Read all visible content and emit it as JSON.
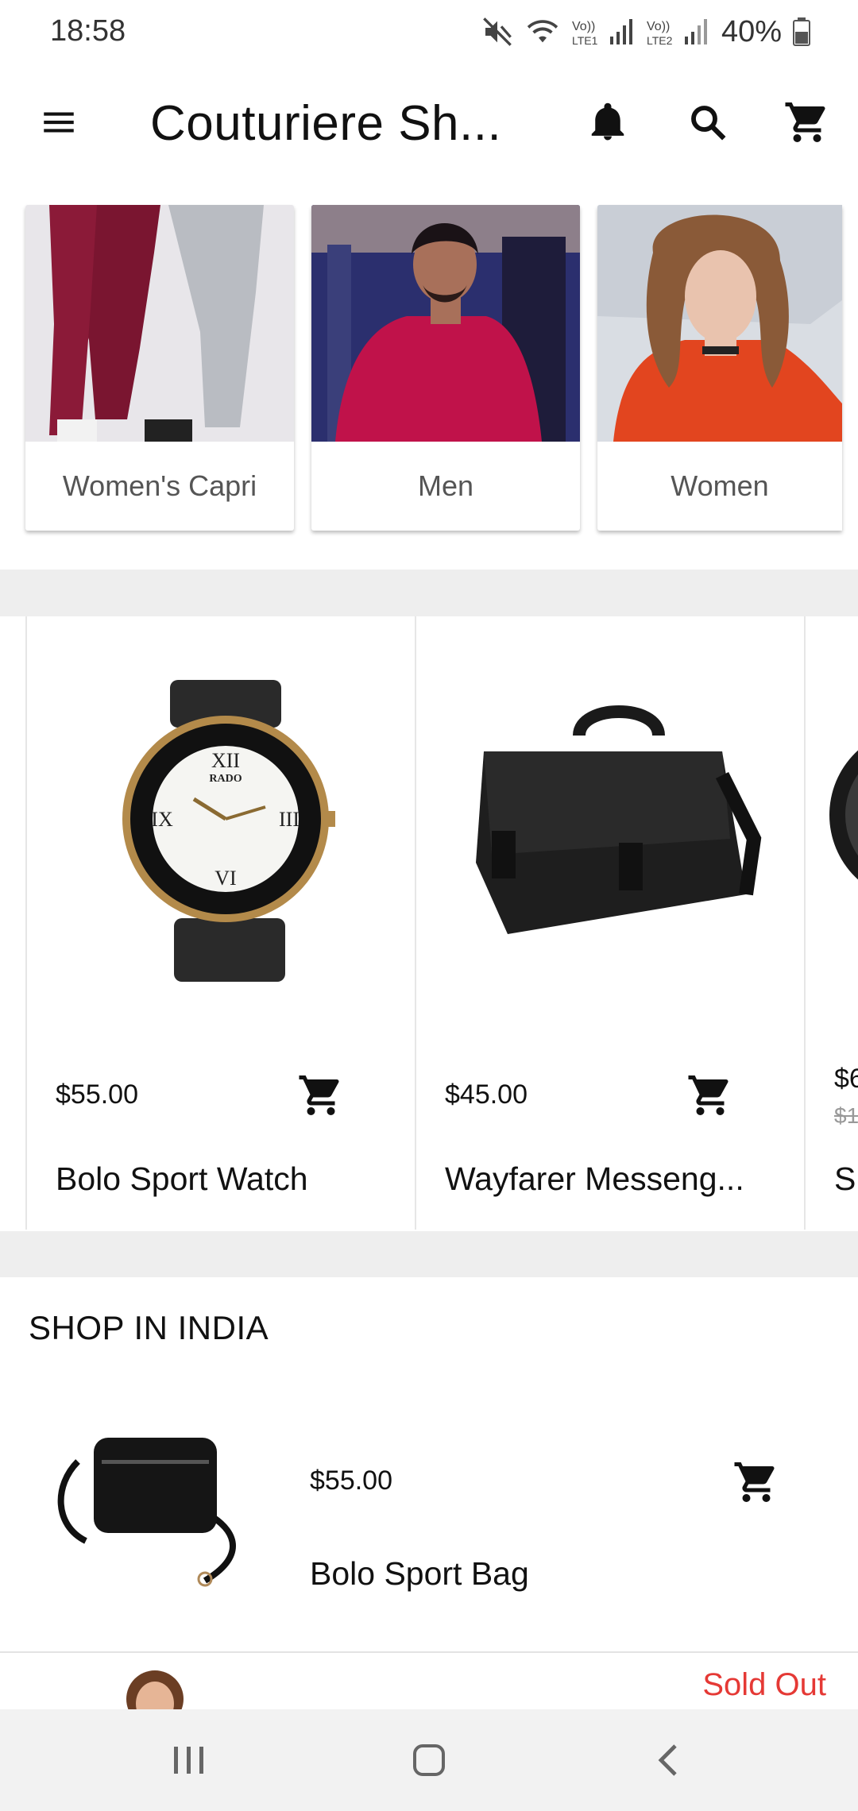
{
  "status_bar": {
    "time": "18:58",
    "battery": "40%",
    "icons": [
      "mute-icon",
      "wifi-icon",
      "lte1-signal-icon",
      "lte2-signal-icon",
      "battery-icon"
    ]
  },
  "app_bar": {
    "title": "Couturiere Sh...",
    "icons": [
      "menu-icon",
      "bell-icon",
      "search-icon",
      "cart-icon"
    ]
  },
  "categories": [
    {
      "label": "Women's Capri"
    },
    {
      "label": "Men"
    },
    {
      "label": "Women"
    }
  ],
  "products": [
    {
      "price": "$55.00",
      "name": "Bolo Sport Watch"
    },
    {
      "price": "$45.00",
      "name": "Wayfarer Messeng..."
    },
    {
      "price": "$6",
      "old_price": "$1",
      "name": "S"
    }
  ],
  "section": {
    "title": "SHOP IN INDIA",
    "items": [
      {
        "price": "$55.00",
        "name": "Bolo Sport Bag"
      },
      {
        "badge": "Sold Out"
      }
    ]
  },
  "colors": {
    "accent_sold_out": "#e53935",
    "separator": "#eeeeee"
  }
}
